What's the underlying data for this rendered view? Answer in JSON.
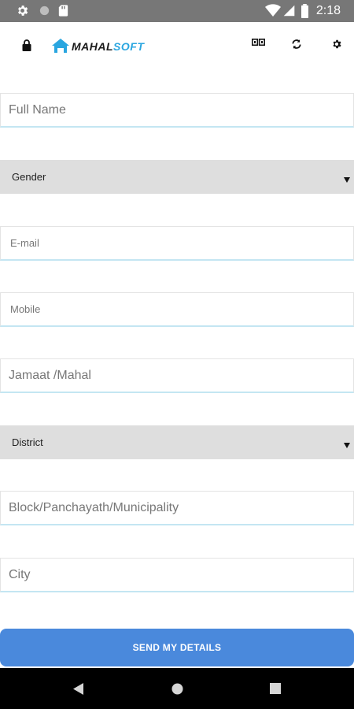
{
  "status_bar": {
    "time": "2:18",
    "icons": [
      "gear-icon",
      "circle-icon",
      "sd-card-icon",
      "wifi-icon",
      "signal-icon",
      "battery-icon"
    ]
  },
  "header": {
    "logo_part1": "MAHAL",
    "logo_part2": "SOFT",
    "icons": [
      "lock-icon",
      "qr-code-icon",
      "refresh-icon",
      "gear-icon"
    ],
    "accent": "#2aa6e0"
  },
  "form": {
    "full_name_placeholder": "Full Name",
    "gender_label": "Gender",
    "email_placeholder": "E-mail",
    "mobile_placeholder": "Mobile",
    "jamaat_placeholder": "Jamaat /Mahal",
    "district_label": "District",
    "block_placeholder": "Block/Panchayath/Municipality",
    "city_placeholder": "City"
  },
  "send_button": {
    "label": "SEND MY DETAILS",
    "color": "#4a89dc"
  },
  "nav_bar": {
    "icons": [
      "back-icon",
      "home-icon",
      "recents-icon"
    ]
  }
}
